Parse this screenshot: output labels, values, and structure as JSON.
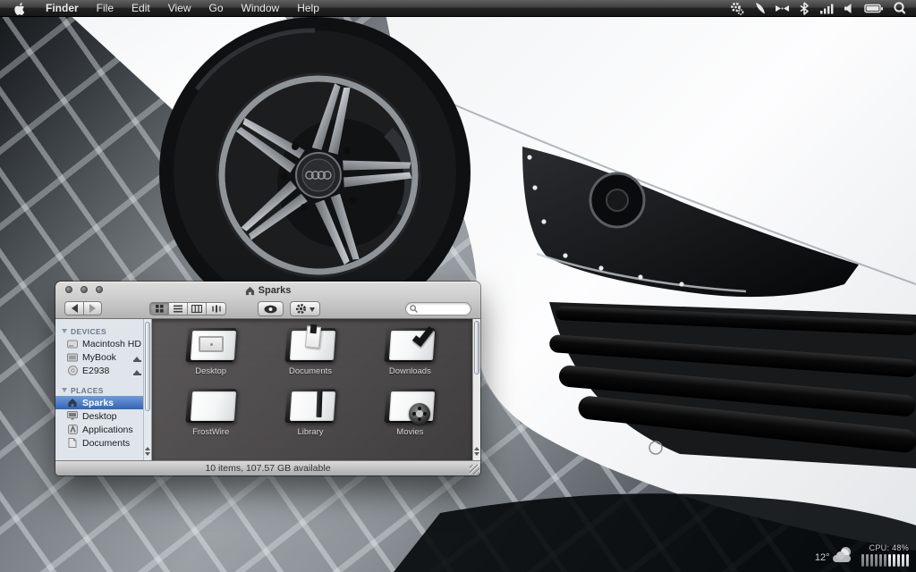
{
  "menu_bar": {
    "menus": [
      "Finder",
      "File",
      "Edit",
      "View",
      "Go",
      "Window",
      "Help"
    ],
    "status_icons": [
      "gears-icon",
      "swoosh-icon",
      "mirroring-icon",
      "bluetooth-icon",
      "signal-bars-icon",
      "volume-icon",
      "battery-icon",
      "spotlight-icon"
    ]
  },
  "finder_window": {
    "title": "Sparks",
    "toolbar": {
      "search_value": ""
    },
    "sidebar": {
      "devices": {
        "header": "DEVICES",
        "items": [
          {
            "label": "Macintosh HD",
            "icon": "internal-drive-icon",
            "ejectable": false
          },
          {
            "label": "MyBook",
            "icon": "external-drive-icon",
            "ejectable": true
          },
          {
            "label": "E2938",
            "icon": "optical-disc-icon",
            "ejectable": true
          }
        ]
      },
      "places": {
        "header": "PLACES",
        "items": [
          {
            "label": "Sparks",
            "icon": "home-icon",
            "selected": true
          },
          {
            "label": "Desktop",
            "icon": "desktop-icon",
            "selected": false
          },
          {
            "label": "Applications",
            "icon": "applications-icon",
            "selected": false
          },
          {
            "label": "Documents",
            "icon": "documents-icon",
            "selected": false
          }
        ]
      }
    },
    "content": {
      "view": "icon",
      "items": [
        {
          "label": "Desktop",
          "icon": "folder-desktop"
        },
        {
          "label": "Documents",
          "icon": "folder-documents"
        },
        {
          "label": "Downloads",
          "icon": "folder-downloads"
        },
        {
          "label": "FrostWire",
          "icon": "folder-plain"
        },
        {
          "label": "Library",
          "icon": "folder-library"
        },
        {
          "label": "Movies",
          "icon": "folder-movies"
        }
      ]
    },
    "status_bar": {
      "text": "10 items, 107.57 GB available"
    }
  },
  "desktop_widgets": {
    "weather": {
      "temperature": "12°",
      "icon": "moon-cloud-icon"
    },
    "cpu": {
      "label": "CPU: 48%",
      "bars_total": 11,
      "bars_bright": 5
    }
  },
  "colors": {
    "selection_blue": "#3464b4",
    "menu_bar_bg": "#232323",
    "content_bg": "#4d4a4b",
    "sidebar_bg": "#dfe5eb",
    "window_chrome": "#c9c9c9"
  }
}
